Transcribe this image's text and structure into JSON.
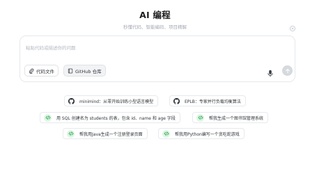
{
  "header": {
    "title": "AI 编程",
    "subtitle": "秒懂代码、智能编码、项目精解"
  },
  "input": {
    "placeholder": "粘贴代码或描述你的问题",
    "code_file_label": "代码文件",
    "github_label": "GitHub 仓库"
  },
  "suggestions": [
    {
      "icon": "github-icon",
      "label": "minimind：从零开始训练小型语言模型"
    },
    {
      "icon": "github-icon",
      "label": "EPLB：专家并行负载均衡算法"
    },
    {
      "icon": "code-icon",
      "label": "用 SQL 创建名为 students 的表，包含 id、name 和 age 字段"
    },
    {
      "icon": "code-icon",
      "label": "帮我生成一个图书馆管理系统"
    },
    {
      "icon": "code-icon",
      "label": "帮我用Java生成一个注册登录页面"
    },
    {
      "icon": "code-icon",
      "label": "帮我用Python编写一个贪吃蛇游戏"
    }
  ],
  "colors": {
    "code_icon_bg": "#dff5e6",
    "code_icon_fg": "#2fa84f",
    "send_button_bg": "#d6d9dd"
  }
}
